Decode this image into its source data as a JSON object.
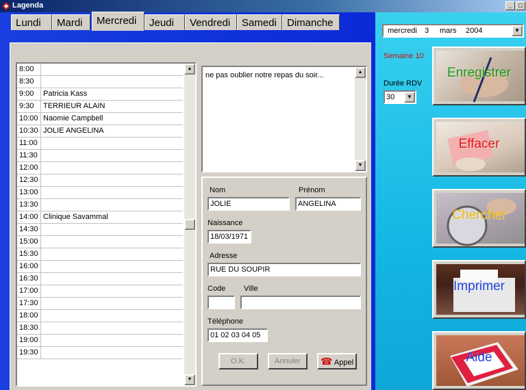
{
  "window": {
    "title": "Lagenda",
    "min": "_",
    "close": "□"
  },
  "tabs": [
    {
      "label": "Lundi"
    },
    {
      "label": "Mardi"
    },
    {
      "label": "Mercredi"
    },
    {
      "label": "Jeudi"
    },
    {
      "label": "Vendredi"
    },
    {
      "label": "Samedi"
    },
    {
      "label": "Dimanche"
    }
  ],
  "active_tab": "Mercredi",
  "schedule": [
    {
      "time": "8:00",
      "name": ""
    },
    {
      "time": "8:30",
      "name": ""
    },
    {
      "time": "9:00",
      "name": "Patricia Kass"
    },
    {
      "time": "9:30",
      "name": "TERRIEUR ALAIN"
    },
    {
      "time": "10:00",
      "name": "Naomie Campbell"
    },
    {
      "time": "10:30",
      "name": "JOLIE ANGELINA"
    },
    {
      "time": "11:00",
      "name": ""
    },
    {
      "time": "11:30",
      "name": ""
    },
    {
      "time": "12:00",
      "name": ""
    },
    {
      "time": "12:30",
      "name": ""
    },
    {
      "time": "13:00",
      "name": ""
    },
    {
      "time": "13:30",
      "name": ""
    },
    {
      "time": "14:00",
      "name": "Clinique Savammal"
    },
    {
      "time": "14:30",
      "name": ""
    },
    {
      "time": "15:00",
      "name": ""
    },
    {
      "time": "15:30",
      "name": ""
    },
    {
      "time": "16:00",
      "name": ""
    },
    {
      "time": "16:30",
      "name": ""
    },
    {
      "time": "17:00",
      "name": ""
    },
    {
      "time": "17:30",
      "name": ""
    },
    {
      "time": "18:00",
      "name": ""
    },
    {
      "time": "18:30",
      "name": ""
    },
    {
      "time": "19:00",
      "name": ""
    },
    {
      "time": "19:30",
      "name": ""
    }
  ],
  "notes": "ne pas oublier notre repas du soir...",
  "form": {
    "nom_label": "Nom",
    "nom": "JOLIE",
    "prenom_label": "Prénom",
    "prenom": "ANGELINA",
    "naissance_label": "Naissance",
    "naissance": "18/03/1971",
    "adresse_label": "Adresse",
    "adresse": "RUE DU SOUPIR",
    "code_label": "Code",
    "code": "",
    "ville_label": "Ville",
    "ville": "",
    "telephone_label": "Téléphone",
    "telephone": "01 02 03 04 05",
    "ok_label": "O.K.",
    "annuler_label": "Annuler",
    "appel_label": "Appel"
  },
  "date": {
    "weekday": "mercredi",
    "day": "3",
    "month": "mars",
    "year": "2004"
  },
  "semaine": "Semaine 10",
  "duree": {
    "label": "Durée RDV",
    "value": "30"
  },
  "actions": {
    "enregistrer": "Enregistrer",
    "effacer": "Effacer",
    "chercher": "Chercher",
    "imprimer": "Imprimer",
    "aide": "Aide"
  },
  "colors": {
    "enregistrer": "#1a9a1a",
    "effacer": "#e01818",
    "chercher": "#f0b800",
    "imprimer": "#2040e0",
    "aide": "#2040e0",
    "semaine": "#c81010"
  }
}
